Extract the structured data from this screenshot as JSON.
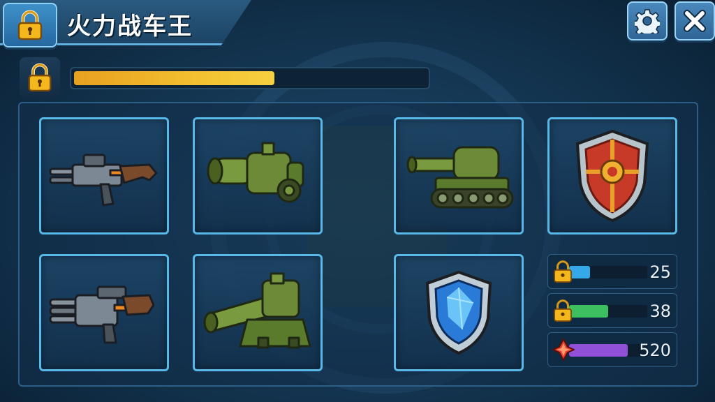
{
  "header": {
    "title": "火力战车王"
  },
  "icons": {
    "header_lock": "lock-icon",
    "progress_lock": "lock-icon",
    "settings": "gear-icon",
    "close": "close-icon"
  },
  "progress": {
    "fraction": 0.57,
    "color": "#f2c030"
  },
  "slots": [
    {
      "item": "assault-rifle"
    },
    {
      "item": "green-cannon"
    },
    {
      "item": "green-tank"
    },
    {
      "item": "red-shield"
    },
    {
      "item": "gatling-gun"
    },
    {
      "item": "artillery-cannon"
    },
    {
      "item": "blue-shield"
    }
  ],
  "stats": [
    {
      "icon": "lock-icon",
      "value": "25",
      "fill": 0.27,
      "color": "#35a8e8"
    },
    {
      "icon": "lock-icon",
      "value": "38",
      "fill": 0.5,
      "color": "#3cc060"
    },
    {
      "icon": "gem-icon",
      "value": "520",
      "fill": 0.75,
      "color": "#9050d8"
    }
  ],
  "colors": {
    "accent": "#58b8e8",
    "lock_gold": "#f0b020"
  }
}
